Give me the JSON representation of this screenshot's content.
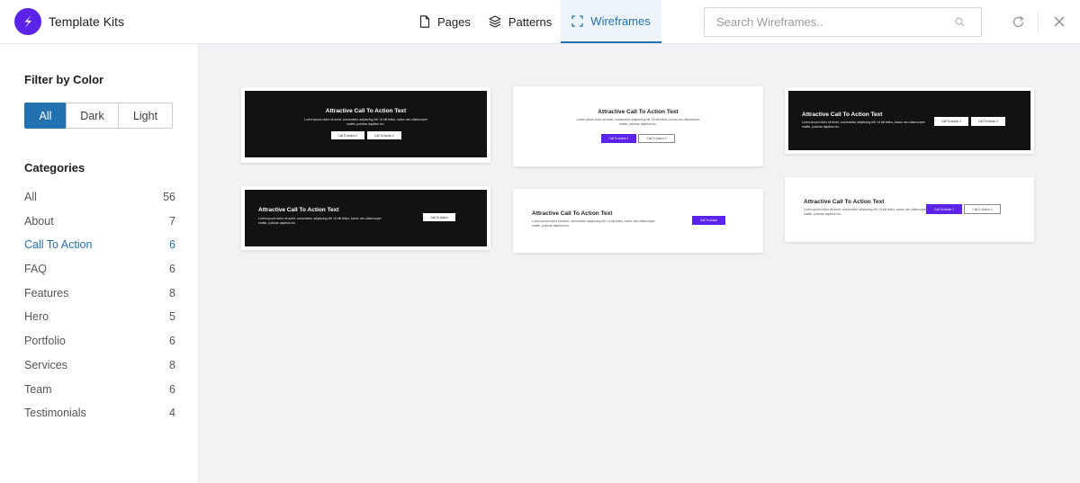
{
  "header": {
    "app_title": "Template Kits",
    "tabs": [
      {
        "label": "Pages",
        "icon": "page-icon",
        "active": false
      },
      {
        "label": "Patterns",
        "icon": "layers-icon",
        "active": false
      },
      {
        "label": "Wireframes",
        "icon": "wireframe-icon",
        "active": true
      }
    ],
    "search_placeholder": "Search Wireframes..",
    "accent_color": "#2271b1",
    "brand_color": "#5b22e8"
  },
  "sidebar": {
    "filter_title": "Filter by Color",
    "color_filters": [
      {
        "label": "All",
        "active": true
      },
      {
        "label": "Dark",
        "active": false
      },
      {
        "label": "Light",
        "active": false
      }
    ],
    "categories_title": "Categories",
    "categories": [
      {
        "label": "All",
        "count": "56",
        "active": false
      },
      {
        "label": "About",
        "count": "7",
        "active": false
      },
      {
        "label": "Call To Action",
        "count": "6",
        "active": true
      },
      {
        "label": "FAQ",
        "count": "6",
        "active": false
      },
      {
        "label": "Features",
        "count": "8",
        "active": false
      },
      {
        "label": "Hero",
        "count": "5",
        "active": false
      },
      {
        "label": "Portfolio",
        "count": "6",
        "active": false
      },
      {
        "label": "Services",
        "count": "8",
        "active": false
      },
      {
        "label": "Team",
        "count": "6",
        "active": false
      },
      {
        "label": "Testimonials",
        "count": "4",
        "active": false
      }
    ]
  },
  "wireframes": {
    "cta_title": "Attractive Call To Action Text",
    "body_line1": "Lorem ipsum dolor sit amet, consectetur adipiscing elit. Ut elit tellus, luctus nec ullamcorper",
    "body_line2": "mattis, pulvinar dapibus leo.",
    "button1": "Call To Action 1",
    "button2": "Call To Action 2",
    "button_single": "Call To Action"
  }
}
